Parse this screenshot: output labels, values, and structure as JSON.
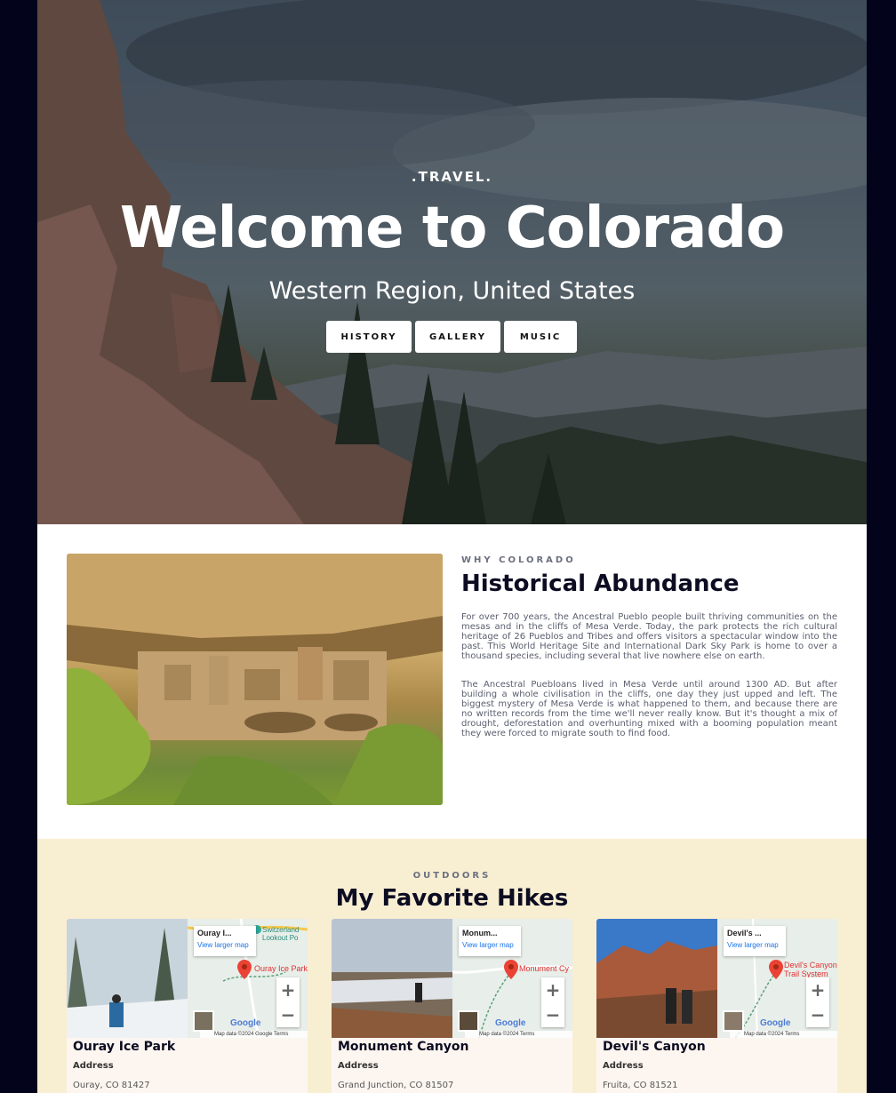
{
  "hero": {
    "kicker": ".TRAVEL.",
    "title": "Welcome to Colorado",
    "subtitle": "Western Region, United States",
    "buttons": [
      {
        "label": "HISTORY"
      },
      {
        "label": "GALLERY"
      },
      {
        "label": "MUSIC"
      }
    ]
  },
  "history": {
    "eyebrow": "WHY COLORADO",
    "title": "Historical Abundance",
    "paragraphs": [
      "For over 700 years, the Ancestral Pueblo people built thriving communities on the mesas and in the cliffs of Mesa Verde. Today, the park protects the rich cultural heritage of 26 Pueblos and Tribes and offers visitors a spectacular window into the past. This World Heritage Site and International Dark Sky Park is home to over a thousand species, including several that live nowhere else on earth.",
      "The Ancestral Puebloans lived in Mesa Verde until around 1300 AD. But after building a whole civilisation in the cliffs, one day they just upped and left. The biggest mystery of Mesa Verde is what happened to them, and because there are no written records from the time we'll never really know. But it's thought a mix of drought, deforestation and overhunting mixed with a booming population meant they were forced to migrate south to find food."
    ]
  },
  "hikes": {
    "eyebrow": "OUTDOORS",
    "title": "My Favorite Hikes",
    "cards": [
      {
        "name": "Ouray Ice Park",
        "map_name": "Ouray I...",
        "pin_label": "Ouray Ice Park",
        "map_link": "View larger map",
        "google": "Google",
        "legal": "Map data ©2024 Google   Terms",
        "address_label": "Address",
        "address": "Ouray, CO 81427",
        "poi": "Switzerland Lookout Po"
      },
      {
        "name": "Monument Canyon",
        "map_name": "Monum...",
        "pin_label": "Monument Cy",
        "map_link": "View larger map",
        "google": "Google",
        "legal": "Map data ©2024   Terms",
        "address_label": "Address",
        "address": "Grand Junction, CO 81507"
      },
      {
        "name": "Devil's Canyon",
        "map_name": "Devil's ...",
        "pin_label": "Devil's Canyon Trail System",
        "map_link": "View larger map",
        "google": "Google",
        "legal": "Map data ©2024   Terms",
        "address_label": "Address",
        "address": "Fruita, CO 81521"
      }
    ]
  },
  "colors": {
    "outer_bg": "#03041c",
    "hikes_bg": "#f8eed2",
    "card_bg": "#fdf6f0",
    "heading": "#0c0c22",
    "pin": "#ea4335",
    "map_link": "#1a73e8"
  },
  "icons": {
    "zoom_in": "plus-icon",
    "zoom_out": "minus-icon",
    "pin": "map-pin-icon"
  }
}
